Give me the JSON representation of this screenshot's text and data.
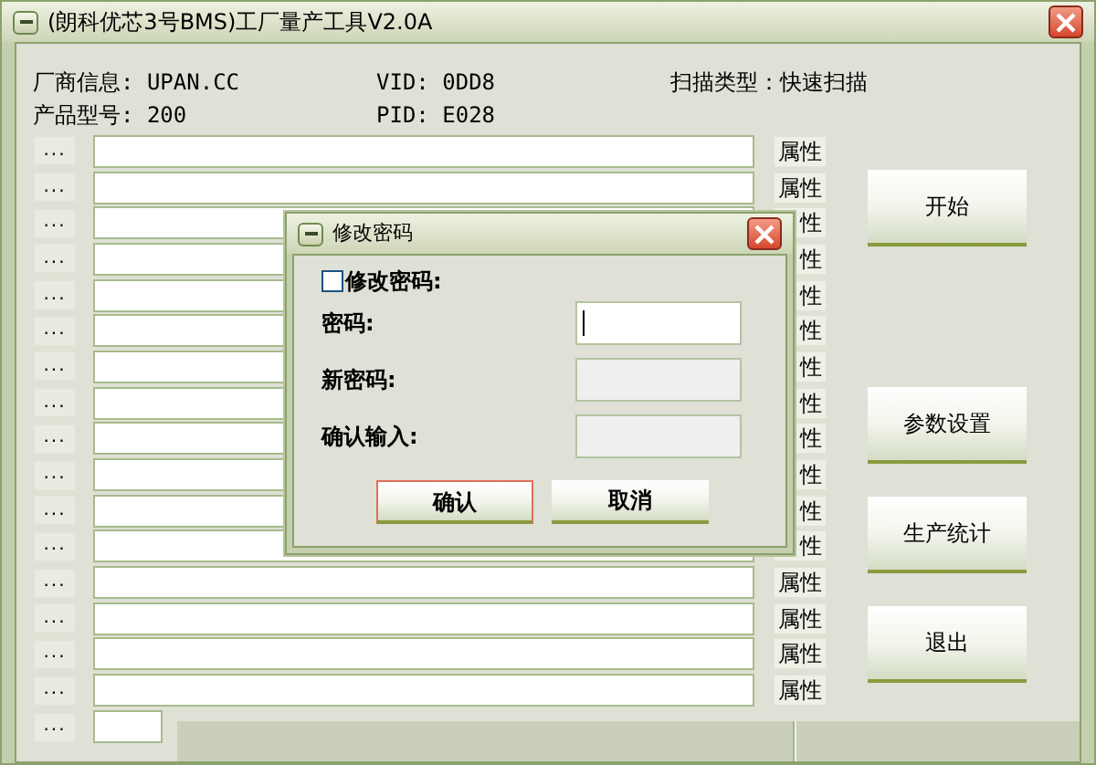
{
  "window": {
    "title": "(朗科优芯3号BMS)工厂量产工具V2.0A"
  },
  "info": [
    {
      "text": "厂商信息: UPAN.CC"
    },
    {
      "text": "VID: 0DD8"
    },
    {
      "text": "扫描类型：快速扫描"
    },
    {
      "text": "产品型号: 200"
    },
    {
      "text": "PID: E028"
    }
  ],
  "rows": [
    {
      "browse": "...",
      "attr": "属性"
    },
    {
      "browse": "...",
      "attr": "属性"
    },
    {
      "browse": "...",
      "attr": "性"
    },
    {
      "browse": "...",
      "attr": "性"
    },
    {
      "browse": "...",
      "attr": "性"
    },
    {
      "browse": "...",
      "attr": "性"
    },
    {
      "browse": "...",
      "attr": "性"
    },
    {
      "browse": "...",
      "attr": "性"
    },
    {
      "browse": "...",
      "attr": "性"
    },
    {
      "browse": "...",
      "attr": "性"
    },
    {
      "browse": "...",
      "attr": "性"
    },
    {
      "browse": "...",
      "attr": "性"
    },
    {
      "browse": "...",
      "attr": "属性"
    },
    {
      "browse": "...",
      "attr": "属性"
    },
    {
      "browse": "...",
      "attr": "属性"
    },
    {
      "browse": "...",
      "attr": "属性"
    }
  ],
  "partial_row": {
    "browse": "..."
  },
  "actions": [
    {
      "label": "开始"
    },
    {
      "label": "参数设置"
    },
    {
      "label": "生产统计"
    },
    {
      "label": "退出"
    }
  ],
  "dialog": {
    "title": "修改密码",
    "checkbox": {
      "label": "修改密码:",
      "checked": false
    },
    "fields": [
      {
        "label": "密码:",
        "disabled": false,
        "focused": true
      },
      {
        "label": "新密码:",
        "disabled": true,
        "focused": false
      },
      {
        "label": "确认输入:",
        "disabled": true,
        "focused": false
      }
    ],
    "buttons": [
      {
        "label": "确认",
        "default": true
      },
      {
        "label": "取消",
        "default": false
      }
    ]
  }
}
